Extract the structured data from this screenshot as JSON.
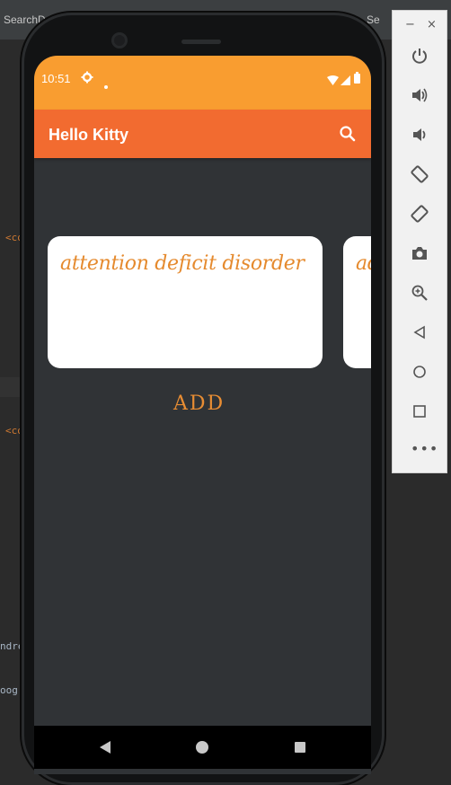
{
  "ide": {
    "tab_left": "SearchD",
    "tab_right": "Se",
    "code_fragments": [
      "<co",
      "<co",
      "ndre",
      "oog"
    ]
  },
  "status_bar": {
    "time": "10:51"
  },
  "app_bar": {
    "title": "Hello Kitty"
  },
  "cards": [
    {
      "text": "attention deficit disorder"
    },
    {
      "text": "ad"
    }
  ],
  "add_button": {
    "label": "ADD"
  },
  "colors": {
    "status_bar": "#f99d30",
    "app_bar": "#f26b30",
    "card_text": "#e58a2e",
    "screen_bg": "#303336"
  },
  "emulator_panel": {
    "minimize": "−",
    "close": "×",
    "buttons": [
      "power-icon",
      "volume-up-icon",
      "volume-down-icon",
      "rotate-left-icon",
      "rotate-right-icon",
      "camera-icon",
      "zoom-icon",
      "back-icon",
      "home-icon",
      "overview-icon",
      "more-icon"
    ]
  }
}
